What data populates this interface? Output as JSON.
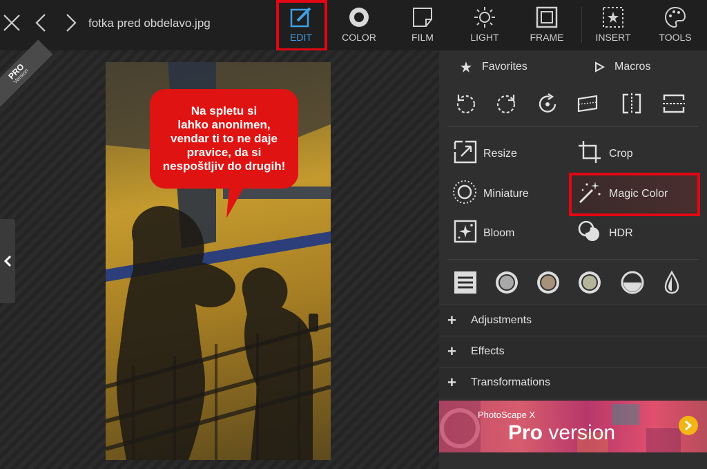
{
  "titlebar": {
    "filename": "fotka pred obdelavo.jpg",
    "close_icon": "close-icon",
    "back_icon": "chevron-left-icon",
    "forward_icon": "chevron-right-icon"
  },
  "toolbar": {
    "tools": [
      {
        "label": "EDIT",
        "icon": "edit-icon",
        "active": true
      },
      {
        "label": "COLOR",
        "icon": "color-icon"
      },
      {
        "label": "FILM",
        "icon": "film-icon"
      },
      {
        "label": "LIGHT",
        "icon": "light-icon"
      },
      {
        "label": "FRAME",
        "icon": "frame-icon"
      },
      {
        "label": "INSERT",
        "icon": "insert-icon"
      },
      {
        "label": "TOOLS",
        "icon": "tools-icon"
      }
    ],
    "accent_color": "#3fa0e8",
    "highlight_color": "#e30613"
  },
  "badge": {
    "pro": "PRO",
    "version": "Version"
  },
  "photo": {
    "speech_bubble": "Na spletu si\nlahko anonimen,\nvendar ti to ne daje\npravice, da si\nnespoštljiv do drugih!",
    "bubble_color": "#e01313"
  },
  "panel": {
    "tabs": [
      {
        "label": "Favorites",
        "icon": "star-icon"
      },
      {
        "label": "Macros",
        "icon": "play-icon"
      }
    ],
    "transform_icons": [
      "rotate-left-icon",
      "rotate-right-icon",
      "rotate-free-icon",
      "straighten-icon",
      "flip-horizontal-icon",
      "flip-vertical-icon"
    ],
    "tools": [
      {
        "label": "Resize",
        "icon": "resize-icon"
      },
      {
        "label": "Crop",
        "icon": "crop-icon"
      },
      {
        "label": "Miniature",
        "icon": "miniature-icon"
      },
      {
        "label": "Magic Color",
        "icon": "magic-wand-icon",
        "highlighted": true
      },
      {
        "label": "Bloom",
        "icon": "bloom-icon"
      },
      {
        "label": "HDR",
        "icon": "hdr-icon"
      }
    ],
    "presets": [
      "list-icon",
      "gray-preset-icon",
      "brown-preset-icon",
      "sage-preset-icon",
      "half-preset-icon",
      "drop-icon"
    ],
    "sections": [
      {
        "label": "Adjustments"
      },
      {
        "label": "Effects"
      },
      {
        "label": "Transformations"
      }
    ],
    "promo": {
      "small": "PhotoScape X",
      "big_bold": "Pro",
      "big_light": " version"
    }
  }
}
